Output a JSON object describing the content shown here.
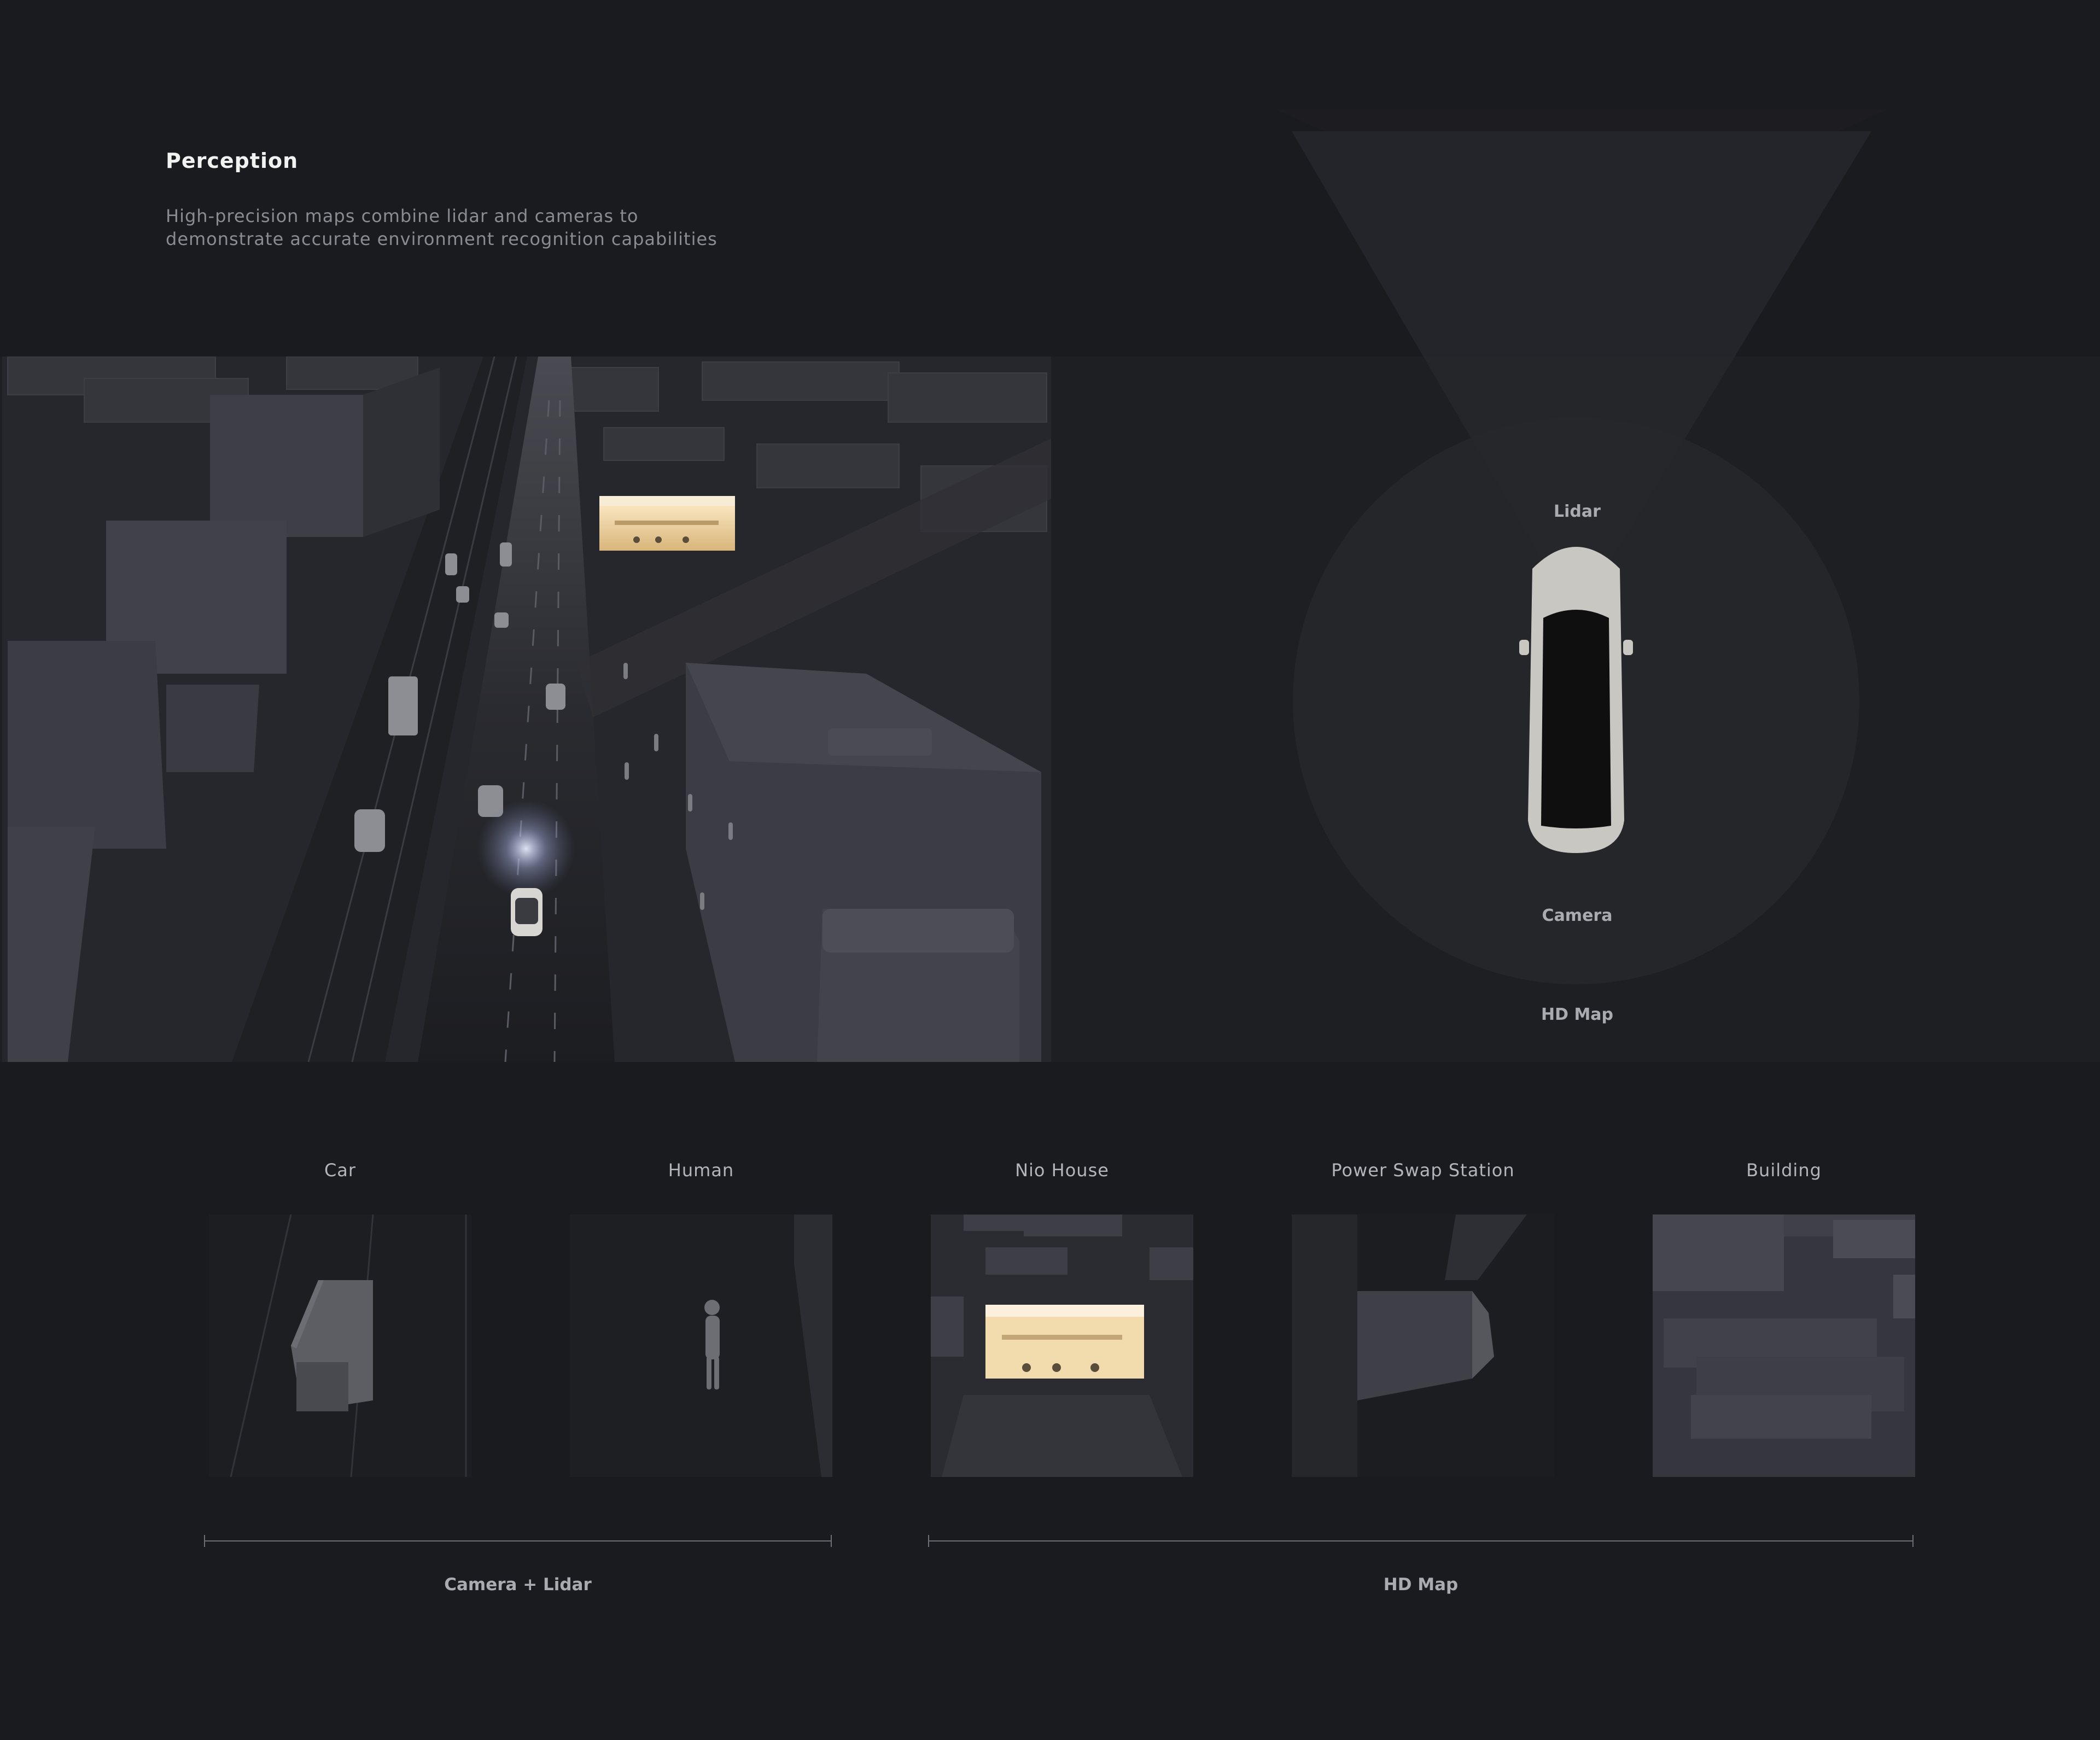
{
  "header": {
    "title": "Perception",
    "description_line1": "High-precision maps combine lidar and cameras to",
    "description_line2": "demonstrate accurate environment recognition capabilities"
  },
  "sensors": {
    "lidar": "Lidar",
    "camera": "Camera",
    "hd_map": "HD Map"
  },
  "categories": [
    {
      "label": "Car"
    },
    {
      "label": "Human"
    },
    {
      "label": "Nio House"
    },
    {
      "label": "Power Swap Station"
    },
    {
      "label": "Building"
    }
  ],
  "groups": [
    {
      "label": "Camera + Lidar"
    },
    {
      "label": "HD Map"
    }
  ],
  "colors": {
    "background": "#1a1b1e",
    "panel": "#1e1f22",
    "nio_house_glow": "#f2dcae"
  }
}
